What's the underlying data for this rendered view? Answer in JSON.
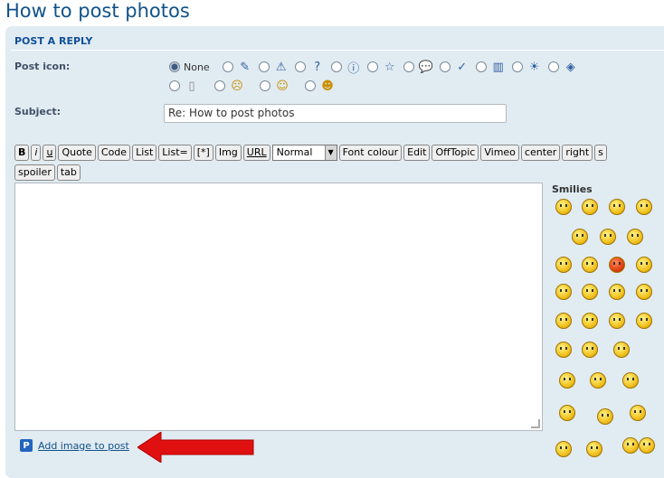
{
  "page": {
    "title": "How to post photos"
  },
  "panel": {
    "heading": "POST A REPLY"
  },
  "post_icon": {
    "label": "Post icon:",
    "none_label": "None",
    "icons": [
      "pencil-icon",
      "warning-icon",
      "question-icon",
      "info-icon",
      "star-icon",
      "speech-bubble-icon",
      "check-icon",
      "film-icon",
      "lightbulb-icon",
      "tag-icon",
      "rip-icon",
      "sad-icon",
      "grin-icon",
      "tongue-icon"
    ]
  },
  "subject": {
    "label": "Subject:",
    "value": "Re: How to post photos"
  },
  "toolbar": {
    "buttons": [
      "B",
      "i",
      "u",
      "Quote",
      "Code",
      "List",
      "List=",
      "[*]",
      "Img",
      "URL"
    ],
    "font_size": "Normal",
    "buttons2": [
      "Font colour",
      "Edit",
      "OffTopic",
      "Vimeo",
      "center",
      "right",
      "s"
    ],
    "buttons3": [
      "spoiler",
      "tab"
    ]
  },
  "smilies": {
    "title": "Smilies"
  },
  "add_image": {
    "label": "Add image to post",
    "icon": "P"
  },
  "colors": {
    "title": "#105289",
    "panel_bg": "#e1ebf2",
    "arrow": "#e01010"
  }
}
